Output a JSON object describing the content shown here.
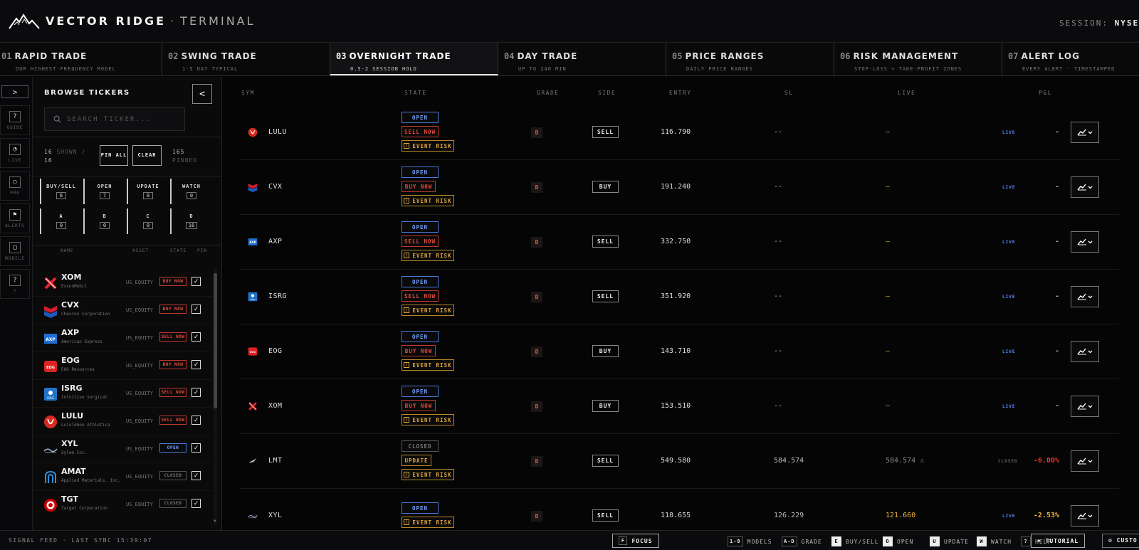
{
  "header": {
    "brand_main": "VECTOR RIDGE",
    "brand_sep": "·",
    "brand_sub": "TERMINAL",
    "session_label": "SESSION:",
    "session_value": "NYSE H"
  },
  "tabs": [
    {
      "num": "01",
      "title": "RAPID TRADE",
      "sub": "OUR HIGHEST-FREQUENCY MODEL"
    },
    {
      "num": "02",
      "title": "SWING TRADE",
      "sub": "1-5 DAY TYPICAL"
    },
    {
      "num": "03",
      "title": "OVERNIGHT TRADE",
      "sub": "0.5-2 SESSION HOLD"
    },
    {
      "num": "04",
      "title": "DAY TRADE",
      "sub": "UP TO 240 MIN"
    },
    {
      "num": "05",
      "title": "PRICE RANGES",
      "sub": "DAILY PRICE RANGES"
    },
    {
      "num": "06",
      "title": "RISK MANAGEMENT",
      "sub": "STOP-LOSS + TAKE-PROFIT ZONES"
    },
    {
      "num": "07",
      "title": "ALERT LOG",
      "sub": "EVERY ALERT · TIMESTAMPED"
    }
  ],
  "rail": {
    "expand": ">",
    "items": [
      {
        "glyph": "?",
        "label": "GUIDE"
      },
      {
        "glyph": "◔",
        "label": "LIVE"
      },
      {
        "glyph": "○",
        "label": "PRO"
      },
      {
        "glyph": "⚑",
        "label": "ALERTS"
      },
      {
        "glyph": "▢",
        "label": "MOBILE"
      },
      {
        "glyph": "?",
        "label": "?"
      }
    ]
  },
  "browse": {
    "title": "BROWSE TICKERS",
    "collapse": "<",
    "search_placeholder": "SEARCH TICKER...",
    "shown_count": "16",
    "shown_label": "SHOWN /",
    "shown_total": "16",
    "pin_all": "PIN ALL",
    "clear": "CLEAR",
    "pinned_count": "165",
    "pinned_label": "PINNED",
    "filters": [
      {
        "label": "BUY/SELL",
        "value": "6"
      },
      {
        "label": "OPEN",
        "value": "7"
      },
      {
        "label": "UPDATE",
        "value": "9"
      },
      {
        "label": "WATCH",
        "value": "0"
      },
      {
        "label": "A",
        "value": "0"
      },
      {
        "label": "B",
        "value": "0"
      },
      {
        "label": "C",
        "value": "0"
      },
      {
        "label": "D",
        "value": "16"
      }
    ],
    "columns": {
      "name": "NAME",
      "asset": "ASSET",
      "state": "STATE",
      "pin": "PIN"
    },
    "tickers": [
      {
        "sym": "XOM",
        "name": "ExxonMobil",
        "asset": "US_EQUITY",
        "state": "BUY NOW",
        "state_type": "buy",
        "pin": "✓"
      },
      {
        "sym": "CVX",
        "name": "Chevron Corporation",
        "asset": "US_EQUITY",
        "state": "BUY NOW",
        "state_type": "buy",
        "pin": "✓"
      },
      {
        "sym": "AXP",
        "name": "American Express",
        "asset": "US_EQUITY",
        "state": "SELL NOW",
        "state_type": "sell",
        "pin": "✓"
      },
      {
        "sym": "EOG",
        "name": "EOG Resources",
        "asset": "US_EQUITY",
        "state": "BUY NOW",
        "state_type": "buy",
        "pin": "✓"
      },
      {
        "sym": "ISRG",
        "name": "Intuitive Surgical",
        "asset": "US_EQUITY",
        "state": "SELL NOW",
        "state_type": "sell",
        "pin": "✓"
      },
      {
        "sym": "LULU",
        "name": "Lululemon Athletica",
        "asset": "US_EQUITY",
        "state": "SELL NOW",
        "state_type": "sell",
        "pin": "✓"
      },
      {
        "sym": "XYL",
        "name": "Xylem Inc.",
        "asset": "US_EQUITY",
        "state": "OPEN",
        "state_type": "open",
        "pin": "✓"
      },
      {
        "sym": "AMAT",
        "name": "Applied Materials, Inc.",
        "asset": "US_EQUITY",
        "state": "CLOSED",
        "state_type": "closed",
        "pin": "✓"
      },
      {
        "sym": "TGT",
        "name": "Target Corporation",
        "asset": "US_EQUITY",
        "state": "CLOSED",
        "state_type": "closed",
        "pin": "✓"
      }
    ]
  },
  "table": {
    "columns": {
      "sym": "SYM",
      "state": "STATE",
      "grade": "GRADE",
      "side": "SIDE",
      "entry": "ENTRY",
      "sl": "SL",
      "live": "LIVE",
      "pnl": "P&L"
    },
    "rows": [
      {
        "sym": "LULU",
        "badges": [
          {
            "text": "OPEN",
            "type": "open"
          },
          {
            "text": "SELL NOW",
            "type": "sell"
          },
          {
            "text": "EVENT RISK",
            "type": "risk"
          }
        ],
        "grade": "D",
        "side": "SELL",
        "entry": "116.790",
        "sl": "--",
        "live": "—",
        "live_tag": "LIVE",
        "pnl": "-",
        "pnl_color": "#aaaaaa"
      },
      {
        "sym": "CVX",
        "badges": [
          {
            "text": "OPEN",
            "type": "open"
          },
          {
            "text": "BUY NOW",
            "type": "buy"
          },
          {
            "text": "EVENT RISK",
            "type": "risk"
          }
        ],
        "grade": "D",
        "side": "BUY",
        "entry": "191.240",
        "sl": "--",
        "live": "—",
        "live_tag": "LIVE",
        "pnl": "-",
        "pnl_color": "#aaaaaa"
      },
      {
        "sym": "AXP",
        "badges": [
          {
            "text": "OPEN",
            "type": "open"
          },
          {
            "text": "SELL NOW",
            "type": "sell"
          },
          {
            "text": "EVENT RISK",
            "type": "risk"
          }
        ],
        "grade": "D",
        "side": "SELL",
        "entry": "332.750",
        "sl": "--",
        "live": "—",
        "live_tag": "LIVE",
        "pnl": "-",
        "pnl_color": "#aaaaaa"
      },
      {
        "sym": "ISRG",
        "badges": [
          {
            "text": "OPEN",
            "type": "open"
          },
          {
            "text": "SELL NOW",
            "type": "sell"
          },
          {
            "text": "EVENT RISK",
            "type": "risk"
          }
        ],
        "grade": "D",
        "side": "SELL",
        "entry": "351.920",
        "sl": "--",
        "live": "—",
        "live_tag": "LIVE",
        "pnl": "-",
        "pnl_color": "#aaaaaa"
      },
      {
        "sym": "EOG",
        "badges": [
          {
            "text": "OPEN",
            "type": "open"
          },
          {
            "text": "BUY NOW",
            "type": "buy"
          },
          {
            "text": "EVENT RISK",
            "type": "risk"
          }
        ],
        "grade": "D",
        "side": "BUY",
        "entry": "143.710",
        "sl": "--",
        "live": "—",
        "live_tag": "LIVE",
        "pnl": "-",
        "pnl_color": "#aaaaaa"
      },
      {
        "sym": "XOM",
        "badges": [
          {
            "text": "OPEN",
            "type": "open"
          },
          {
            "text": "BUY NOW",
            "type": "buy"
          },
          {
            "text": "EVENT RISK",
            "type": "risk"
          }
        ],
        "grade": "D",
        "side": "BUY",
        "entry": "153.510",
        "sl": "--",
        "live": "—",
        "live_tag": "LIVE",
        "pnl": "-",
        "pnl_color": "#aaaaaa"
      },
      {
        "sym": "LMT",
        "badges": [
          {
            "text": "CLOSED",
            "type": "closed"
          },
          {
            "text": "UPDATE",
            "type": "update"
          },
          {
            "text": "EVENT RISK",
            "type": "risk"
          }
        ],
        "grade": "D",
        "side": "SELL",
        "entry": "549.580",
        "sl": "584.574",
        "live": "584.574 ⚠",
        "live_color": "#888888",
        "live_tag": "CLOSED",
        "pnl": "-6.00%",
        "pnl_color": "#e0392b"
      },
      {
        "sym": "XYL",
        "badges": [
          {
            "text": "OPEN",
            "type": "open"
          },
          {
            "text": "EVENT RISK",
            "type": "risk"
          }
        ],
        "grade": "D",
        "side": "SELL",
        "entry": "118.655",
        "sl": "126.229",
        "live": "121.660",
        "live_color": "#f2b33d",
        "live_tag": "LIVE",
        "pnl": "-2.53%",
        "pnl_color": "#f2b33d"
      }
    ]
  },
  "footer": {
    "feed": "SIGNAL FEED · LAST SYNC 15:39:07",
    "focus_key": "F",
    "focus_label": "FOCUS",
    "shortcuts": [
      {
        "key": "1-8",
        "label": "MODELS",
        "white": false
      },
      {
        "key": "A-D",
        "label": "GRADE",
        "white": false
      },
      {
        "key": "E",
        "label": "BUY/SELL",
        "white": true
      },
      {
        "key": "O",
        "label": "OPEN",
        "white": true
      },
      {
        "key": "U",
        "label": "UPDATE",
        "white": true
      },
      {
        "key": "W",
        "label": "WATCH",
        "white": true
      },
      {
        "key": "?",
        "label": "HELP",
        "white": false
      }
    ],
    "tutorial": "• TUTORIAL",
    "custom": "⚙ CUSTO"
  },
  "colors": {
    "live_tag": "#5b8cff",
    "closed_tag": "#666666",
    "accent_orange": "#e0a43a",
    "sell_red": "#e74c3c"
  }
}
